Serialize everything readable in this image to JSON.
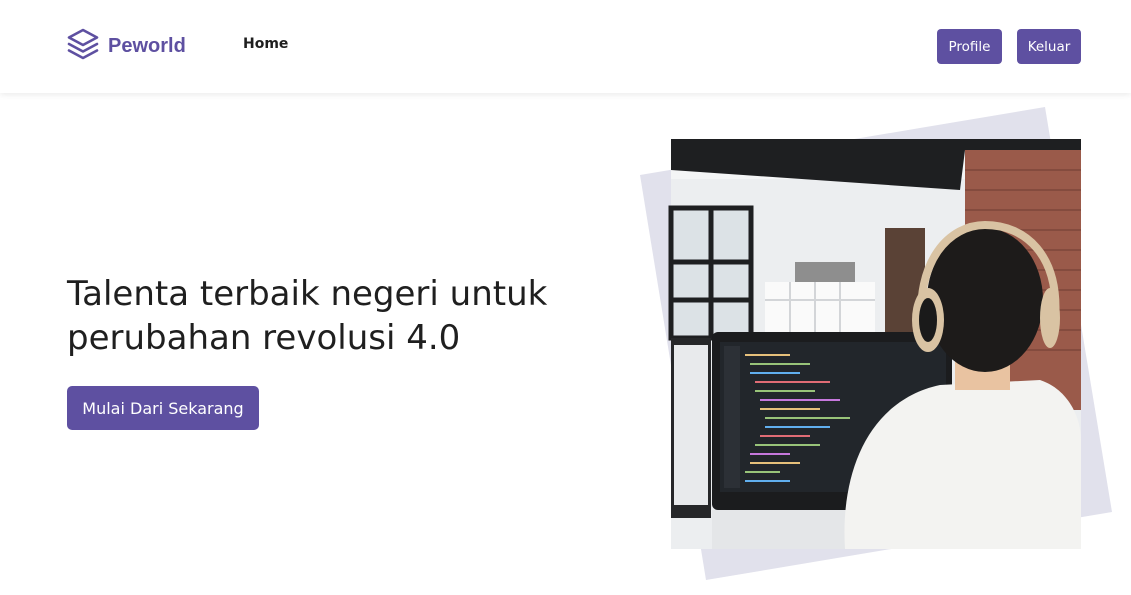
{
  "navbar": {
    "brand": "Peworld",
    "links": [
      {
        "label": "Home"
      }
    ],
    "buttons": {
      "profile": "Profile",
      "logout": "Keluar"
    }
  },
  "hero": {
    "title_line1": "Talenta terbaik negeri untuk",
    "title_line2": "perubahan revolusi 4.0",
    "cta_label": "Mulai Dari Sekarang"
  },
  "colors": {
    "brand": "#5E50A1",
    "decor": "#E1E1EC",
    "text": "#1F1F1F"
  }
}
